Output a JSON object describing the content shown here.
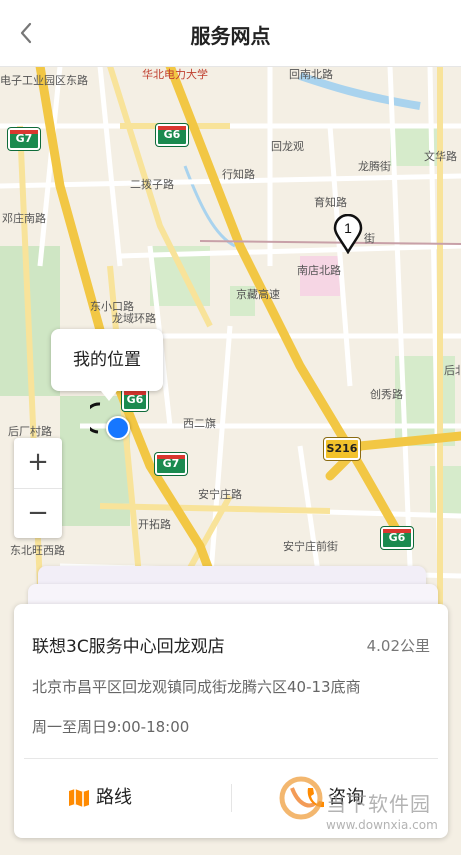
{
  "header": {
    "title": "服务网点"
  },
  "map": {
    "labels": {
      "university": "华北电力大学",
      "huilongguan_n_rd": "回南北路",
      "industrial_park": "电子工业园区东路",
      "huilongguan": "回龙观",
      "xingzhi_rd": "行知路",
      "erbozi_rd": "二拨子路",
      "yuzhi_rd": "育知路",
      "longteng_st": "龙腾街",
      "wenhua_rd": "文华路",
      "dengnan_rd": "邓庄南路",
      "nandian_n_rd": "南店北路",
      "jingzang_exp": "京藏高速",
      "longyu_ring": "龙域环路",
      "dongzhi_rd": "东小口路",
      "xierqi": "西二旗",
      "anning_zhuang_rd": "安宁庄路",
      "anning_zhuang_front_st": "安宁庄前街",
      "kaituo_rd": "开拓路",
      "houchang_village_rd": "后厂村路",
      "houbei_rd": "后北路",
      "chuangxiu_rd": "创秀路",
      "road_jie": "街",
      "dongbei_west_rd": "东北旺西路",
      "houchang_village": "后厂村路"
    },
    "shields": {
      "g7_top": "G7",
      "g6_top": "G6",
      "g7_mid": "G7",
      "s216": "S216",
      "g6_bottom": "G6",
      "g6_small": "G6"
    },
    "marker_number": "1",
    "my_location_label": "我的位置",
    "zoom_in": "+",
    "zoom_out": "−"
  },
  "store": {
    "name": "联想3C服务中心回龙观店",
    "distance": "4.02公里",
    "address": "北京市昌平区回龙观镇同成街龙腾六区40-13底商",
    "hours": "周一至周日9:00-18:00",
    "route_label": "路线",
    "consult_label": "咨询"
  },
  "watermark": {
    "text": "当下软件园",
    "url": "www.downxia.com"
  },
  "colors": {
    "accent": "#ff8a00",
    "location_dot": "#1677ff",
    "highway": "#f2c744"
  }
}
